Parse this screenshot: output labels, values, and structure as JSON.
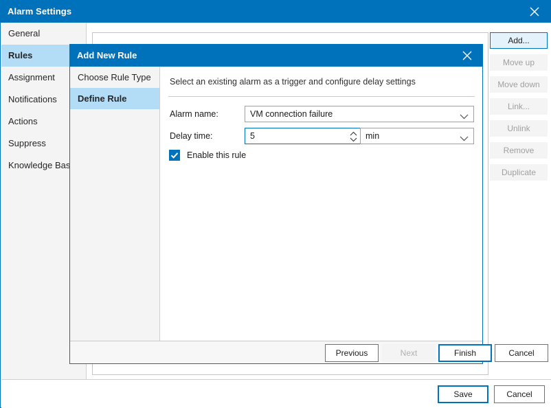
{
  "window": {
    "title": "Alarm Settings",
    "close_icon": "close-icon"
  },
  "sidebar": {
    "items": [
      {
        "label": "General",
        "selected": false
      },
      {
        "label": "Rules",
        "selected": true
      },
      {
        "label": "Assignment",
        "selected": false
      },
      {
        "label": "Notifications",
        "selected": false
      },
      {
        "label": "Actions",
        "selected": false
      },
      {
        "label": "Suppress",
        "selected": false
      },
      {
        "label": "Knowledge Base",
        "selected": false
      }
    ]
  },
  "action_buttons": [
    {
      "label": "Add...",
      "enabled": true
    },
    {
      "label": "Move up",
      "enabled": false
    },
    {
      "label": "Move down",
      "enabled": false
    },
    {
      "label": "Link...",
      "enabled": false
    },
    {
      "label": "Unlink",
      "enabled": false
    },
    {
      "label": "Remove",
      "enabled": false
    },
    {
      "label": "Duplicate",
      "enabled": false
    }
  ],
  "window_footer": {
    "save_label": "Save",
    "cancel_label": "Cancel"
  },
  "dialog": {
    "title": "Add New Rule",
    "close_icon": "close-icon",
    "steps": [
      {
        "label": "Choose Rule Type",
        "selected": false
      },
      {
        "label": "Define Rule",
        "selected": true
      }
    ],
    "description": "Select an existing alarm as a trigger and configure delay settings",
    "form": {
      "alarm_name_label": "Alarm name:",
      "alarm_name_value": "VM connection failure",
      "delay_time_label": "Delay time:",
      "delay_time_value": "5",
      "delay_unit_value": "min",
      "enable_rule_label": "Enable this rule",
      "enable_rule_checked": true
    },
    "footer": {
      "previous_label": "Previous",
      "next_label": "Next",
      "finish_label": "Finish",
      "cancel_label": "Cancel"
    }
  },
  "colors": {
    "accent_blue": "#0072bc",
    "selection_blue": "#b3dcf6",
    "panel_gray": "#f4f4f4",
    "disabled_text": "#a0a0a0"
  }
}
